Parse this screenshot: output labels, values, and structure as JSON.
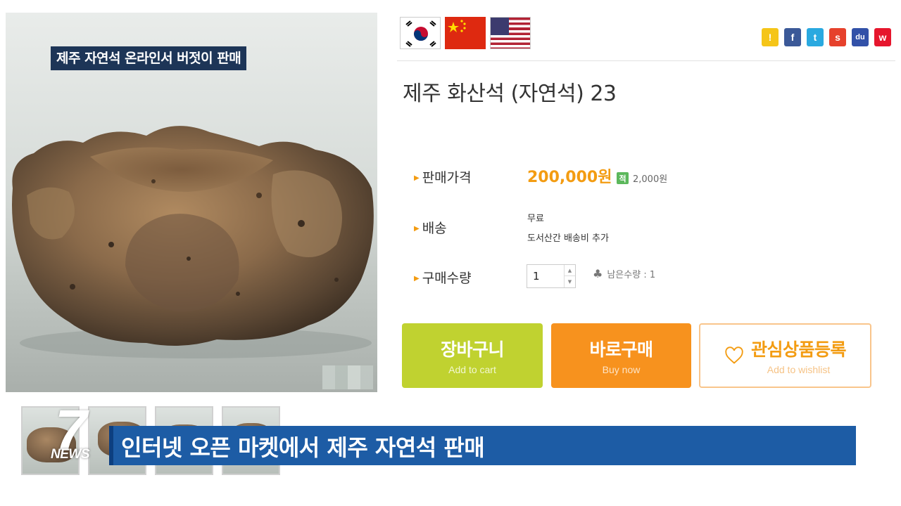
{
  "photo": {
    "caption": "제주 자연석 온라인서 버젓이 판매"
  },
  "languages": [
    {
      "name": "korean-flag-icon"
    },
    {
      "name": "china-flag-icon"
    },
    {
      "name": "us-flag-icon"
    }
  ],
  "social": [
    {
      "name": "kakaostory-icon",
      "glyph": "!",
      "color": "#f5c518"
    },
    {
      "name": "facebook-icon",
      "glyph": "f",
      "color": "#3b5998"
    },
    {
      "name": "twitter-icon",
      "glyph": "t",
      "color": "#2aa9e0"
    },
    {
      "name": "me2day-icon",
      "glyph": "s",
      "color": "#e6412c"
    },
    {
      "name": "baidu-icon",
      "glyph": "du",
      "color": "#3251a8"
    },
    {
      "name": "weibo-icon",
      "glyph": "w",
      "color": "#e6162d"
    }
  ],
  "product": {
    "title": "제주 화산석 (자연석) 23",
    "price_label": "판매가격",
    "price": "200,000원",
    "points": "2,000원",
    "points_icon": "적",
    "shipping_label": "배송",
    "shipping_line1": "무료",
    "shipping_line2": "도서산간 배송비 추가",
    "quantity_label": "구매수량",
    "quantity_value": "1",
    "stock_text": "남은수량 : 1"
  },
  "buttons": {
    "cart_main": "장바구니",
    "cart_sub": "Add to cart",
    "buy_main": "바로구매",
    "buy_sub": "Buy now",
    "wish_main": "관심상품등록",
    "wish_sub": "Add to wishlist"
  },
  "news": {
    "headline": "인터넷 오픈 마켓에서 제주 자연석 판매",
    "logo_number": "7",
    "logo_text": "NEWS"
  },
  "colors": {
    "accent_orange": "#f39c12",
    "cart_green": "#c0d230",
    "buy_orange": "#f7921e",
    "news_blue": "#1d5ca5"
  }
}
